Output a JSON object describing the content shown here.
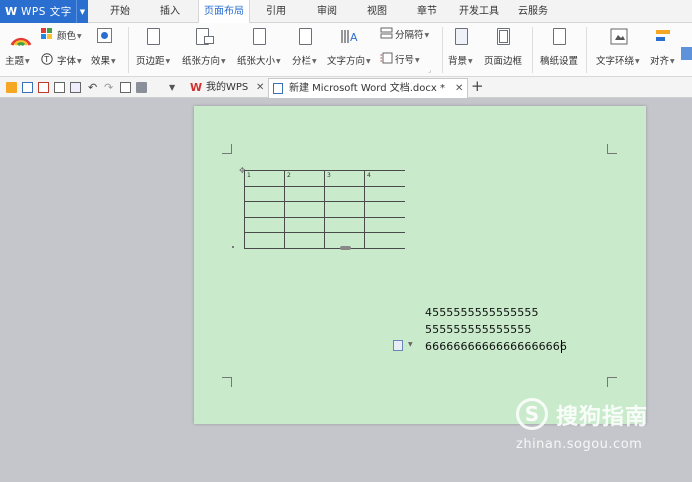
{
  "app": {
    "title": "WPS 文字",
    "logo": "W"
  },
  "menu": {
    "tabs": [
      {
        "label": "开始"
      },
      {
        "label": "插入"
      },
      {
        "label": "页面布局",
        "active": true
      },
      {
        "label": "引用"
      },
      {
        "label": "审阅"
      },
      {
        "label": "视图"
      },
      {
        "label": "章节"
      },
      {
        "label": "开发工具"
      },
      {
        "label": "云服务"
      }
    ]
  },
  "ribbon": {
    "theme": "主题",
    "color": "颜色",
    "font": "字体",
    "effect": "效果",
    "margins": "页边距",
    "orientation": "纸张方向",
    "size": "纸张大小",
    "columns": "分栏",
    "text_direction": "文字方向",
    "breaks": "分隔符",
    "line_numbers": "行号",
    "background": "背景",
    "page_border": "页面边框",
    "manuscript": "稿纸设置",
    "text_wrap": "文字环绕",
    "align": "对齐"
  },
  "doc_tabs": [
    {
      "label": "我的WPS",
      "icon": "wps-logo-icon"
    },
    {
      "label": "新建 Microsoft Word 文档.docx *",
      "icon": "document-icon",
      "active": true
    }
  ],
  "document": {
    "table_header": [
      "1",
      "2",
      "3",
      "4"
    ],
    "lines": [
      "4555555555555555",
      "555555555555555",
      "66666666666666666666"
    ]
  },
  "watermark": {
    "brand": "搜狗指南",
    "url": "zhinan.sogou.com",
    "mark": "S"
  },
  "colors": {
    "accent": "#2a6fd0",
    "page_background": "#c9ebcc",
    "workspace": "#c5c6cb"
  }
}
